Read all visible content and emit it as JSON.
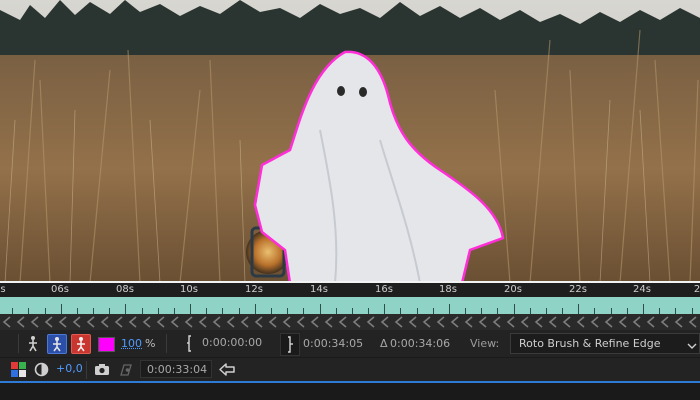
{
  "viewer": {
    "image": "ghost-in-field",
    "colors": {
      "mask_outline": "#ff2ed8",
      "sky": "#c9c9c5",
      "grass": "#8a6a44",
      "sheet": "#e4e6ea"
    }
  },
  "timeline": {
    "ticks": [
      "s",
      "06s",
      "08s",
      "10s",
      "12s",
      "14s",
      "16s",
      "18s",
      "20s",
      "22s",
      "24s",
      "2"
    ],
    "bar_color": "#8fd3c6"
  },
  "toolbar": {
    "color_swatch": "#ff00ff",
    "opacity_value": "100",
    "opacity_unit": "%",
    "start_time": "0:00:00:00",
    "end_time": "0:00:34:05",
    "duration_prefix": "Δ",
    "duration": "0:00:34:06",
    "view_label": "View:",
    "view_value": "Roto Brush & Refine Edge",
    "exposure": "+0,0",
    "current_time": "0:00:33:04"
  },
  "icons": {
    "person": "person-icon",
    "alpha_person": "alpha-person-icon",
    "red_person": "alpha-overlay-icon",
    "start_bracket": "start-bracket-icon",
    "end_bracket": "end-bracket-icon",
    "view_chevron": "chevron-down-icon",
    "color_channels": "color-channels-icon",
    "exposure_reset": "exposure-icon",
    "snapshot": "camera-icon",
    "show_snapshot": "show-snapshot-icon",
    "go_back": "arrow-left-icon"
  }
}
